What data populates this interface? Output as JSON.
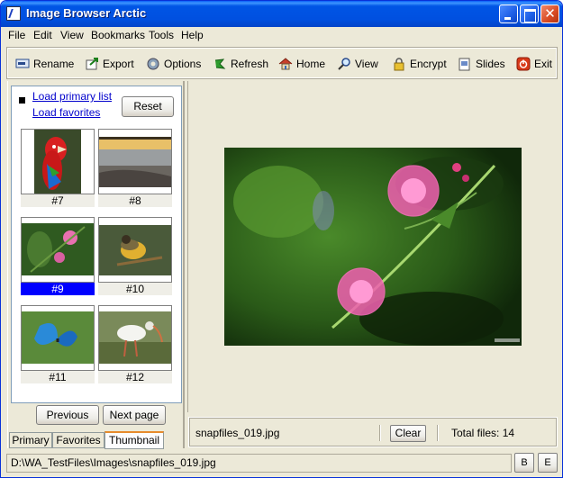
{
  "window": {
    "title": "Image Browser Arctic"
  },
  "menu": [
    "File",
    "Edit",
    "View",
    "Bookmarks",
    "Tools",
    "Help"
  ],
  "toolbar": {
    "rename": "Rename",
    "export": "Export",
    "options": "Options",
    "refresh": "Refresh",
    "home": "Home",
    "view": "View",
    "encrypt": "Encrypt",
    "slides": "Slides",
    "exit": "Exit"
  },
  "sidebar": {
    "load_primary": "Load primary list",
    "load_favorites": "Load favorites",
    "reset": "Reset",
    "thumbnails": [
      {
        "label": "#7",
        "selected": false
      },
      {
        "label": "#8",
        "selected": false
      },
      {
        "label": "#9",
        "selected": true
      },
      {
        "label": "#10",
        "selected": false
      },
      {
        "label": "#11",
        "selected": false
      },
      {
        "label": "#12",
        "selected": false
      }
    ],
    "previous": "Previous",
    "next_page": "Next page",
    "tabs": {
      "primary": "Primary",
      "favorites": "Favorites",
      "thumbnail": "Thumbnail"
    },
    "active_tab": "Thumbnail"
  },
  "preview": {
    "file_name": "snapfiles_019.jpg",
    "clear": "Clear",
    "total_files": "Total files:  14"
  },
  "statusbar": {
    "path": "D:\\WA_TestFiles\\Images\\snapfiles_019.jpg",
    "b": "B",
    "e": "E"
  },
  "colors": {
    "titlebar": "#0055e5",
    "selection": "#0000ff",
    "link": "#0000cc",
    "window_bg": "#ece9d8"
  }
}
